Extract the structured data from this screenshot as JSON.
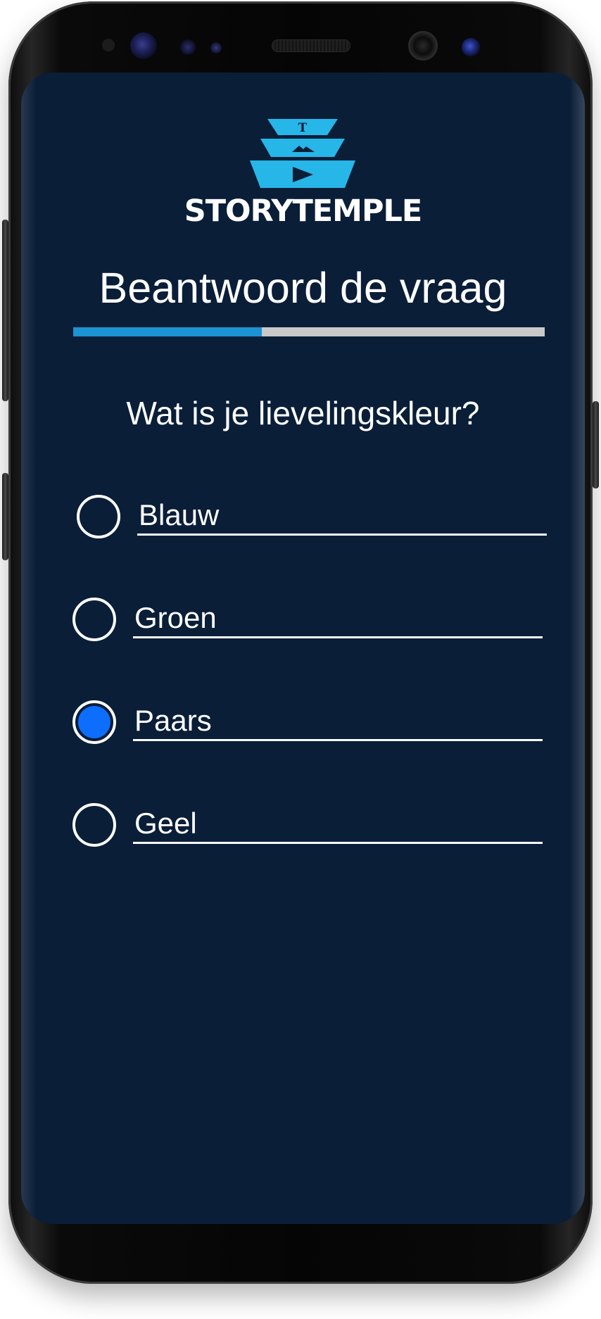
{
  "app": {
    "brand": "STORYTEMPLE",
    "logo_letter": "T"
  },
  "page": {
    "title": "Beantwoord de vraag"
  },
  "progress": {
    "fraction": 0.4
  },
  "question": {
    "text": "Wat is je lievelingskleur?"
  },
  "options": [
    {
      "label": "Blauw",
      "selected": false
    },
    {
      "label": "Groen",
      "selected": false
    },
    {
      "label": "Paars",
      "selected": true
    },
    {
      "label": "Geel",
      "selected": false
    }
  ],
  "colors": {
    "background": "#0a1e38",
    "accent": "#1c93d2",
    "logo": "#27b6e8",
    "radio_selected": "#0d6efd",
    "progress_track": "#c9c9c9",
    "text": "#ffffff"
  }
}
